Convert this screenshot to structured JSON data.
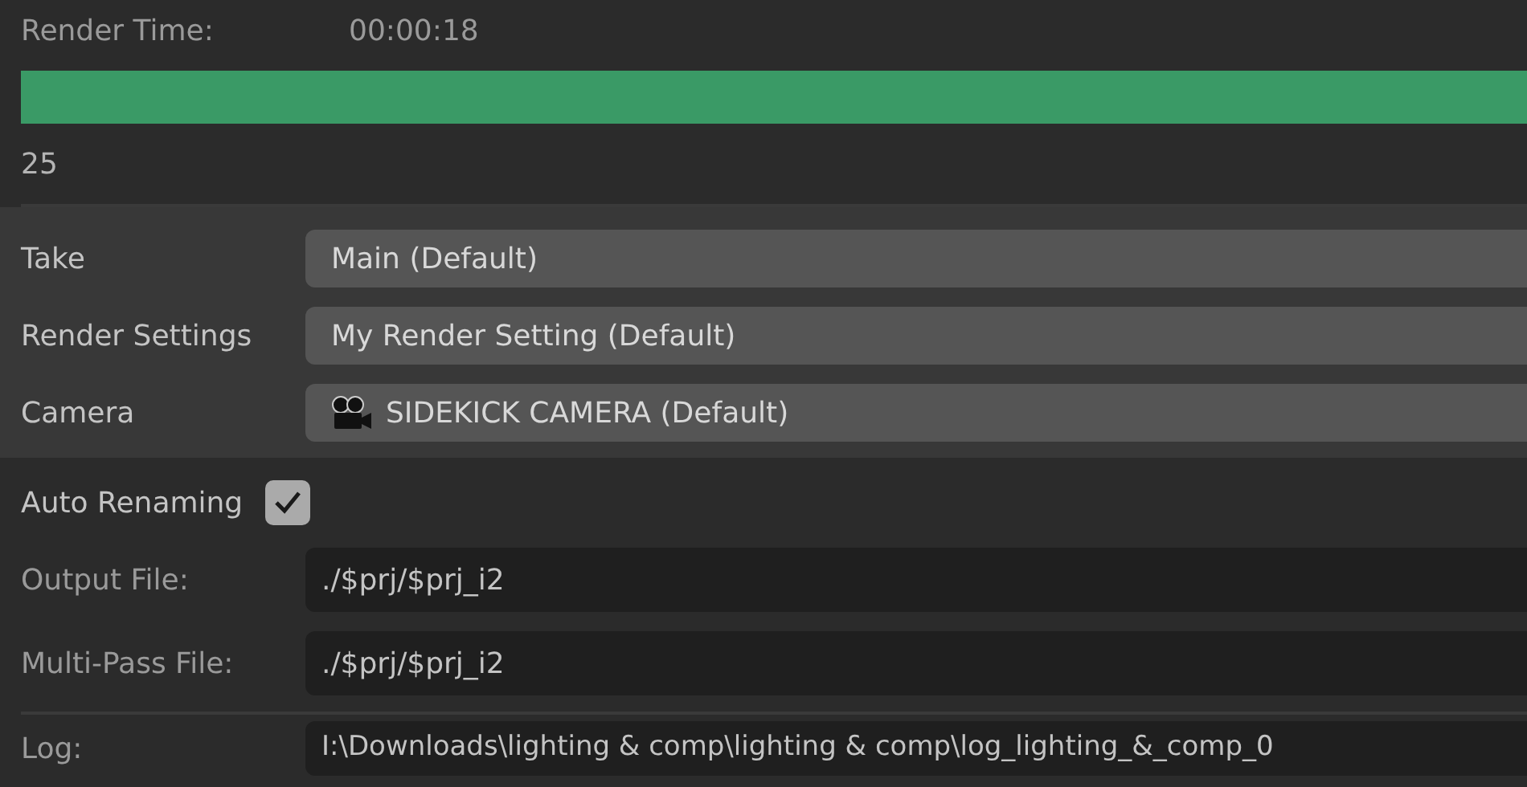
{
  "render_time": {
    "label": "Render Time:",
    "value": "00:00:18"
  },
  "progress": {
    "level": 1
  },
  "frame": "25",
  "selectors": [
    {
      "label": "Take",
      "value": "Main (Default)",
      "kind": "plain"
    },
    {
      "label": "Render Settings",
      "value": "My Render Setting (Default)",
      "kind": "plain"
    },
    {
      "label": "Camera",
      "value": "SIDEKICK CAMERA (Default)",
      "kind": "camera"
    }
  ],
  "auto_renaming": {
    "label": "Auto Renaming",
    "checked": true
  },
  "files": [
    {
      "label": "Output File:",
      "value": "./$prj/$prj_i2"
    },
    {
      "label": "Multi-Pass File:",
      "value": "./$prj/$prj_i2"
    }
  ],
  "log": {
    "label": "Log:",
    "value": "I:\\Downloads\\lighting & comp\\lighting & comp\\log_lighting_&_comp_0"
  }
}
